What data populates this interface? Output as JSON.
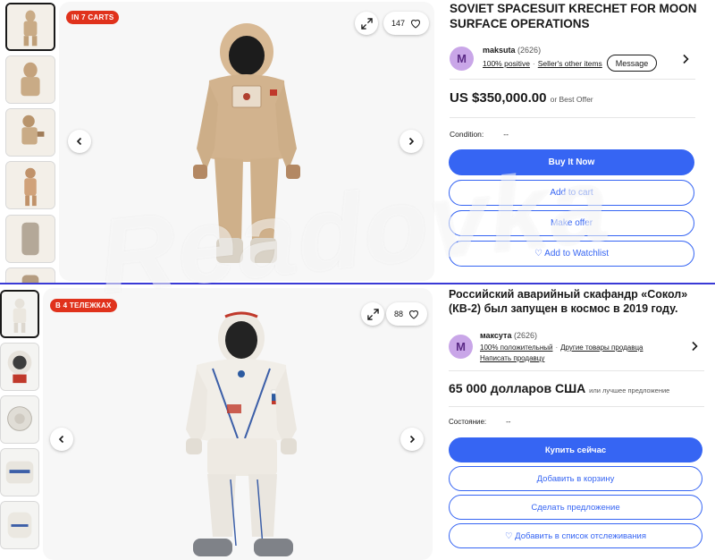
{
  "listing_en": {
    "badge": "IN 7 CARTS",
    "watch_count": "147",
    "title": "SOVIET SPACESUIT KRECHET FOR MOON SURFACE OPERATIONS",
    "seller": {
      "initial": "M",
      "name": "maksuta",
      "feedback_count": "(2626)",
      "positive": "100% positive",
      "other_items": "Seller's other items",
      "message_label": "Message"
    },
    "price": "US $350,000.00",
    "price_note": "or Best Offer",
    "condition_label": "Condition:",
    "condition_value": "--",
    "buy_now": "Buy It Now",
    "add_to_cart": "Add to cart",
    "make_offer": "Make offer",
    "watchlist": "♡ Add to Watchlist"
  },
  "listing_ru": {
    "badge": "В 4 ТЕЛЕЖКАХ",
    "watch_count": "88",
    "title": "Российский аварийный скафандр «Сокол» (КВ-2) был запущен в космос в 2019 году.",
    "seller": {
      "initial": "M",
      "name": "максута",
      "feedback_count": "(2626)",
      "positive": "100% положительный",
      "other_items": "Другие товары продавца",
      "write_seller": "Написать продавцу"
    },
    "price": "65 000 долларов США",
    "price_note": "или лучшее предложение",
    "condition_label": "Состояние:",
    "condition_value": "--",
    "buy_now": "Купить сейчас",
    "add_to_cart": "Добавить в корзину",
    "make_offer": "Сделать предложение",
    "watchlist": "♡ Добавить в список отслеживания"
  },
  "watermark": "Readovka",
  "colors": {
    "accent": "#3665f3",
    "badge": "#e0321c",
    "avatar_bg": "#c9a6e8",
    "divider": "#3a3ad6"
  },
  "icons": [
    "expand-icon",
    "heart-icon",
    "chevron-left-icon",
    "chevron-right-icon"
  ]
}
